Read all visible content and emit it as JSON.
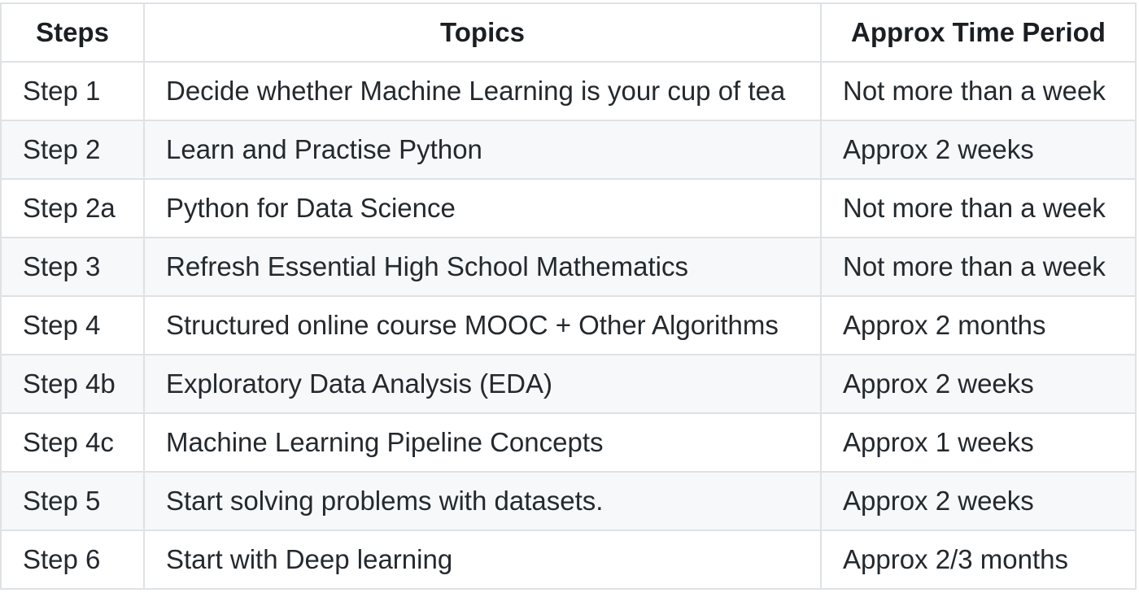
{
  "table": {
    "headers": [
      "Steps",
      "Topics",
      "Approx Time Period"
    ],
    "rows": [
      {
        "step": "Step 1",
        "topic": "Decide whether Machine Learning is your cup of tea",
        "time": "Not more than a week"
      },
      {
        "step": "Step 2",
        "topic": "Learn and Practise Python",
        "time": "Approx 2 weeks"
      },
      {
        "step": "Step 2a",
        "topic": "Python for Data Science",
        "time": "Not more than a week"
      },
      {
        "step": "Step 3",
        "topic": "Refresh Essential High School Mathematics",
        "time": "Not more than a week"
      },
      {
        "step": "Step 4",
        "topic": "Structured online course MOOC + Other Algorithms",
        "time": "Approx 2 months"
      },
      {
        "step": "Step 4b",
        "topic": "Exploratory Data Analysis (EDA)",
        "time": "Approx 2 weeks"
      },
      {
        "step": "Step 4c",
        "topic": "Machine Learning Pipeline Concepts",
        "time": "Approx 1 weeks"
      },
      {
        "step": "Step 5",
        "topic": "Start solving problems with datasets.",
        "time": "Approx 2 weeks"
      },
      {
        "step": "Step 6",
        "topic": "Start with Deep learning",
        "time": "Approx 2/3 months"
      }
    ]
  }
}
